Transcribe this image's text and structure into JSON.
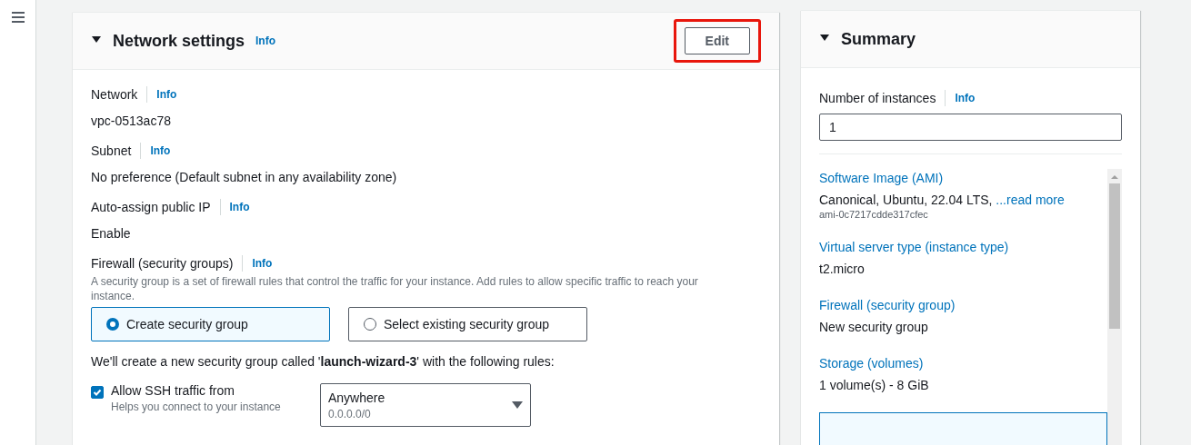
{
  "network_settings": {
    "title": "Network settings",
    "info": "Info",
    "expanded": true,
    "edit_button": {
      "label": "Edit",
      "highlighted": true
    },
    "fields": [
      {
        "label": "Network",
        "info": "Info",
        "value": "vpc-0513ac78"
      },
      {
        "label": "Subnet",
        "info": "Info",
        "value": "No preference (Default subnet in any availability zone)"
      },
      {
        "label": "Auto-assign public IP",
        "info": "Info",
        "value": "Enable"
      }
    ],
    "firewall": {
      "label": "Firewall (security groups)",
      "info": "Info",
      "description": "A security group is a set of firewall rules that control the traffic for your instance. Add rules to allow specific traffic to reach your instance.",
      "options": [
        {
          "label": "Create security group",
          "selected": true
        },
        {
          "label": "Select existing security group",
          "selected": false
        }
      ],
      "note": "We'll create a new security group called '**launch-wizard-3**' with the following rules:",
      "rules": [
        {
          "label": "Allow SSH traffic from",
          "hint": "Helps you connect to your instance",
          "checked": true,
          "source": {
            "value": "Anywhere",
            "detail": "0.0.0.0/0"
          }
        }
      ]
    }
  },
  "summary": {
    "title": "Summary",
    "expanded": true,
    "instances": {
      "label": "Number of instances",
      "info": "Info",
      "value": "1"
    },
    "items": [
      {
        "title": "Software Image (AMI)",
        "value": "Canonical, Ubuntu, 22.04 LTS, ",
        "link": "...read more",
        "detail": "ami-0c7217cdde317cfec"
      },
      {
        "title": "Virtual server type (instance type)",
        "value": "t2.micro"
      },
      {
        "title": "Firewall (security group)",
        "value": "New security group"
      },
      {
        "title": "Storage (volumes)",
        "value": "1 volume(s) - 8 GiB"
      }
    ]
  }
}
